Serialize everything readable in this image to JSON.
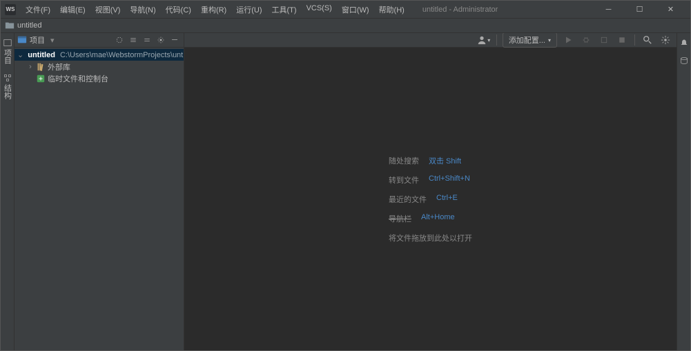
{
  "window": {
    "title": "untitled - Administrator"
  },
  "menu": {
    "file": "文件(F)",
    "edit": "编辑(E)",
    "view": "视图(V)",
    "navigate": "导航(N)",
    "code": "代码(C)",
    "refactor": "重构(R)",
    "run": "运行(U)",
    "tools": "工具(T)",
    "vcs": "VCS(S)",
    "window": "窗口(W)",
    "help": "帮助(H)"
  },
  "breadcrumb": {
    "project": "untitled"
  },
  "toolbar": {
    "add_config": "添加配置..."
  },
  "sidebar": {
    "project": "项目",
    "structure": "结构"
  },
  "project_panel": {
    "title": "项目"
  },
  "tree": {
    "root": {
      "name": "untitled",
      "path": "C:\\Users\\mae\\WebstormProjects\\untitled"
    },
    "ext_libs": "外部库",
    "scratches": "临时文件和控制台"
  },
  "hints": {
    "search": {
      "label": "随处搜索",
      "key": "双击 Shift"
    },
    "goto_file": {
      "label": "转到文件",
      "key": "Ctrl+Shift+N"
    },
    "recent": {
      "label": "最近的文件",
      "key": "Ctrl+E"
    },
    "navbar": {
      "label": "导航栏",
      "key": "Alt+Home"
    },
    "drop": "将文件拖放到此处以打开"
  }
}
